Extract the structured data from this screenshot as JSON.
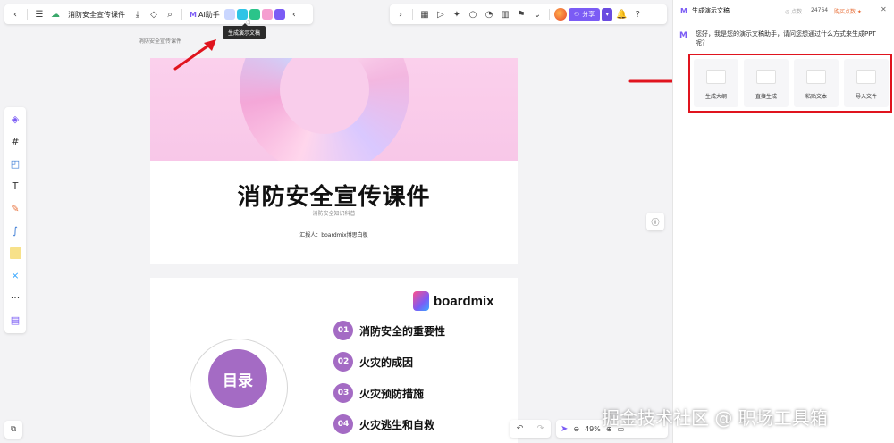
{
  "toolbar": {
    "doc_title": "消防安全宣传课件",
    "ai_label": "AI助手",
    "ai_logo": "M",
    "share_label": "分享"
  },
  "tooltip": {
    "text": "生成演示文稿"
  },
  "frame": {
    "label": "消防安全宣传课件"
  },
  "slide1": {
    "title": "消防安全宣传课件",
    "subtitle": "消防安全知识科普",
    "reporter": "汇报人：boardmix博思白板"
  },
  "slide2": {
    "brand": "boardmix",
    "toc_title": "目录",
    "items": [
      {
        "num": "01",
        "text": "消防安全的重要性"
      },
      {
        "num": "02",
        "text": "火灾的成因"
      },
      {
        "num": "03",
        "text": "火灾预防措施"
      },
      {
        "num": "04",
        "text": "火灾逃生和自救"
      }
    ]
  },
  "zoom": {
    "level": "49%"
  },
  "panel": {
    "title": "生成演示文稿",
    "points_label": "点数",
    "points_value": "24764",
    "buy_label": "购买点数",
    "greeting": "您好，我是您的演示文稿助手，请问您想通过什么方式来生成PPT呢？",
    "options": [
      "生成大纲",
      "直接生成",
      "粘贴文本",
      "导入文件"
    ]
  },
  "watermark": "掘金技术社区 @ 职场工具箱",
  "colors": {
    "accent": "#7b5cf5",
    "toc_purple": "#a46bc4",
    "annotation_red": "#e0141e",
    "hero_pink": "#f8c7e8"
  },
  "icons": [
    "back-icon",
    "menu-icon",
    "cloud-icon",
    "download-icon",
    "tag-icon",
    "search-icon",
    "ppt-icon",
    "info-icon",
    "undo-icon",
    "redo-icon",
    "pointer-icon",
    "zoom-out-icon",
    "zoom-in-icon",
    "map-icon",
    "bell-icon",
    "help-icon"
  ]
}
